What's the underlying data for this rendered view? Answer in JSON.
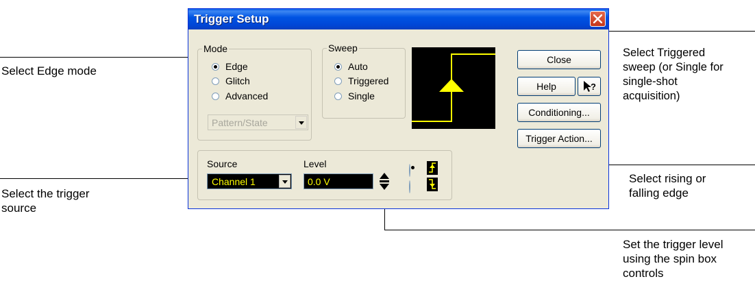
{
  "dialog": {
    "title": "Trigger Setup",
    "mode": {
      "label": "Mode",
      "options": [
        "Edge",
        "Glitch",
        "Advanced"
      ],
      "selected": "Edge",
      "dropdown_value": "Pattern/State"
    },
    "sweep": {
      "label": "Sweep",
      "options": [
        "Auto",
        "Triggered",
        "Single"
      ],
      "selected": "Auto"
    },
    "buttons": {
      "close": "Close",
      "help": "Help",
      "conditioning": "Conditioning...",
      "trigger_action": "Trigger Action..."
    },
    "source": {
      "label": "Source",
      "value": "Channel 1"
    },
    "level": {
      "label": "Level",
      "value": "0.0 V"
    },
    "slope": {
      "selected": "rising"
    },
    "colors": {
      "display_bg": "#000000",
      "trace": "#ffff00",
      "titlebar": "#0054e3"
    }
  },
  "annotations": {
    "edge_mode": "Select Edge mode",
    "triggered_sweep": [
      "Select Triggered",
      "sweep (or Single for",
      "single-shot",
      "acquisition)"
    ],
    "trigger_source": [
      "Select the trigger",
      "source"
    ],
    "slope_edge": [
      "Select rising or",
      "falling edge"
    ],
    "trigger_level": [
      "Set the trigger level",
      "using the spin box",
      "controls"
    ]
  }
}
